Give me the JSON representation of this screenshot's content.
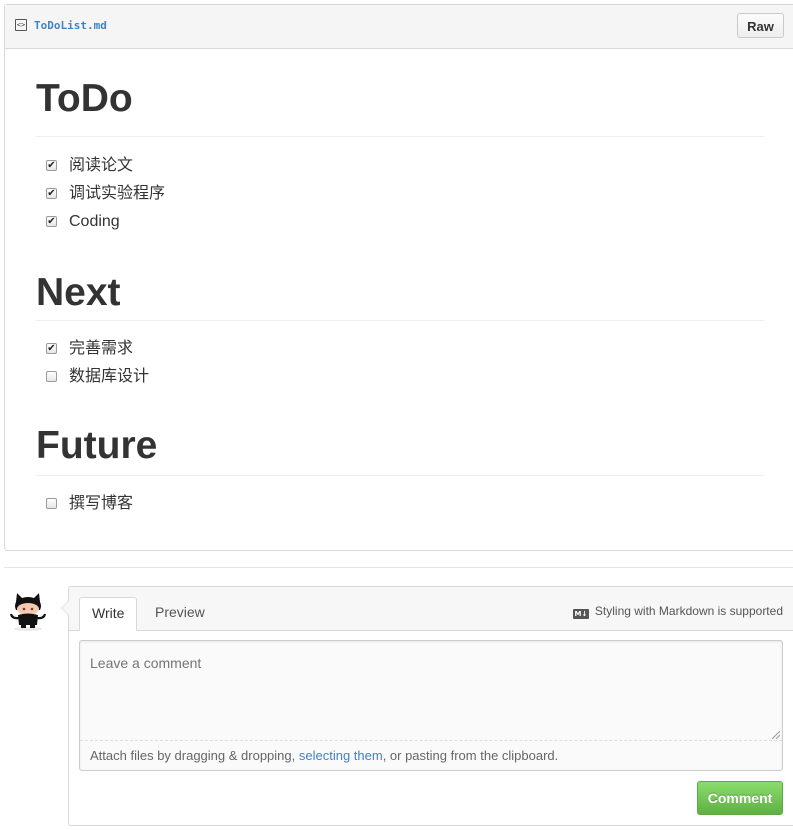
{
  "file": {
    "icon": "code-file-icon",
    "name": "ToDoList.md",
    "raw_label": "Raw"
  },
  "markdown": {
    "sections": [
      {
        "heading": "ToDo",
        "items": [
          {
            "label": "阅读论文",
            "checked": true
          },
          {
            "label": "调试实验程序",
            "checked": true
          },
          {
            "label": "Coding",
            "checked": true
          }
        ]
      },
      {
        "heading": "Next",
        "items": [
          {
            "label": "完善需求",
            "checked": true
          },
          {
            "label": "数据库设计",
            "checked": false
          }
        ]
      },
      {
        "heading": "Future",
        "items": [
          {
            "label": "撰写博客",
            "checked": false
          }
        ]
      }
    ]
  },
  "comment": {
    "avatar_icon": "octocat-avatar-icon",
    "tabs": [
      {
        "label": "Write",
        "active": true
      },
      {
        "label": "Preview",
        "active": false
      }
    ],
    "markdown_note": "Styling with Markdown is supported",
    "markdown_icon": "markdown-icon",
    "placeholder": "Leave a comment",
    "attach_text_before": "Attach files by dragging & dropping, ",
    "attach_link": "selecting them",
    "attach_text_after": ", or pasting from the clipboard.",
    "submit_label": "Comment"
  },
  "colors": {
    "link": "#4183c4",
    "accent_green": "#60b044",
    "border": "#d8d8d8"
  }
}
